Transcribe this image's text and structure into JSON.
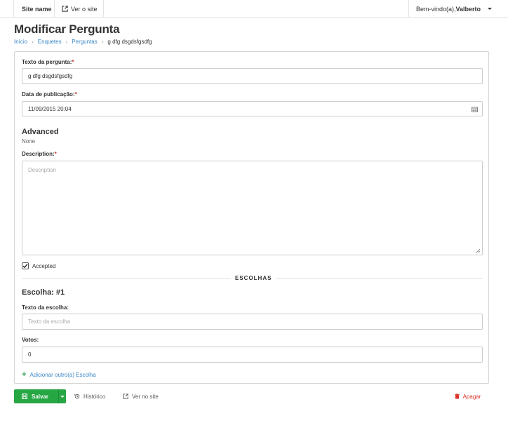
{
  "navbar": {
    "site_name": "Site name",
    "view_site": "Ver o site",
    "welcome": "Bem-vindo(a),",
    "username": "Valberto"
  },
  "page": {
    "title": "Modificar Pergunta"
  },
  "breadcrumb": {
    "home": "Início",
    "app": "Enquetes",
    "model": "Perguntas",
    "current": "g dfg dsgdsfgsdfg"
  },
  "form": {
    "question_label": "Texto da pergunta:",
    "question_value": "g dfg dsgdsfgsdfg",
    "pubdate_label": "Data de publicação:",
    "pubdate_value": "11/09/2015 20:04",
    "advanced_title": "Advanced",
    "advanced_value": "None",
    "description_label": "Description:",
    "description_placeholder": "Description",
    "accepted_label": "Accepted",
    "accepted_checked": true,
    "required_mark": "*"
  },
  "choices": {
    "section_title": "ESCOLHAS",
    "item_title": "Escolha: #1",
    "choice_label": "Texto da escolha:",
    "choice_placeholder": "Texto da escolha",
    "votes_label": "Votos:",
    "votes_value": "0",
    "add_label": "Adicionar outro(a) Escolha"
  },
  "actions": {
    "save": "Salvar",
    "history": "Histórico",
    "view_on_site": "Ver no site",
    "delete": "Apagar"
  },
  "colors": {
    "primary_green": "#27a644",
    "link_blue": "#3a86c8",
    "danger_red": "#d9342b"
  }
}
